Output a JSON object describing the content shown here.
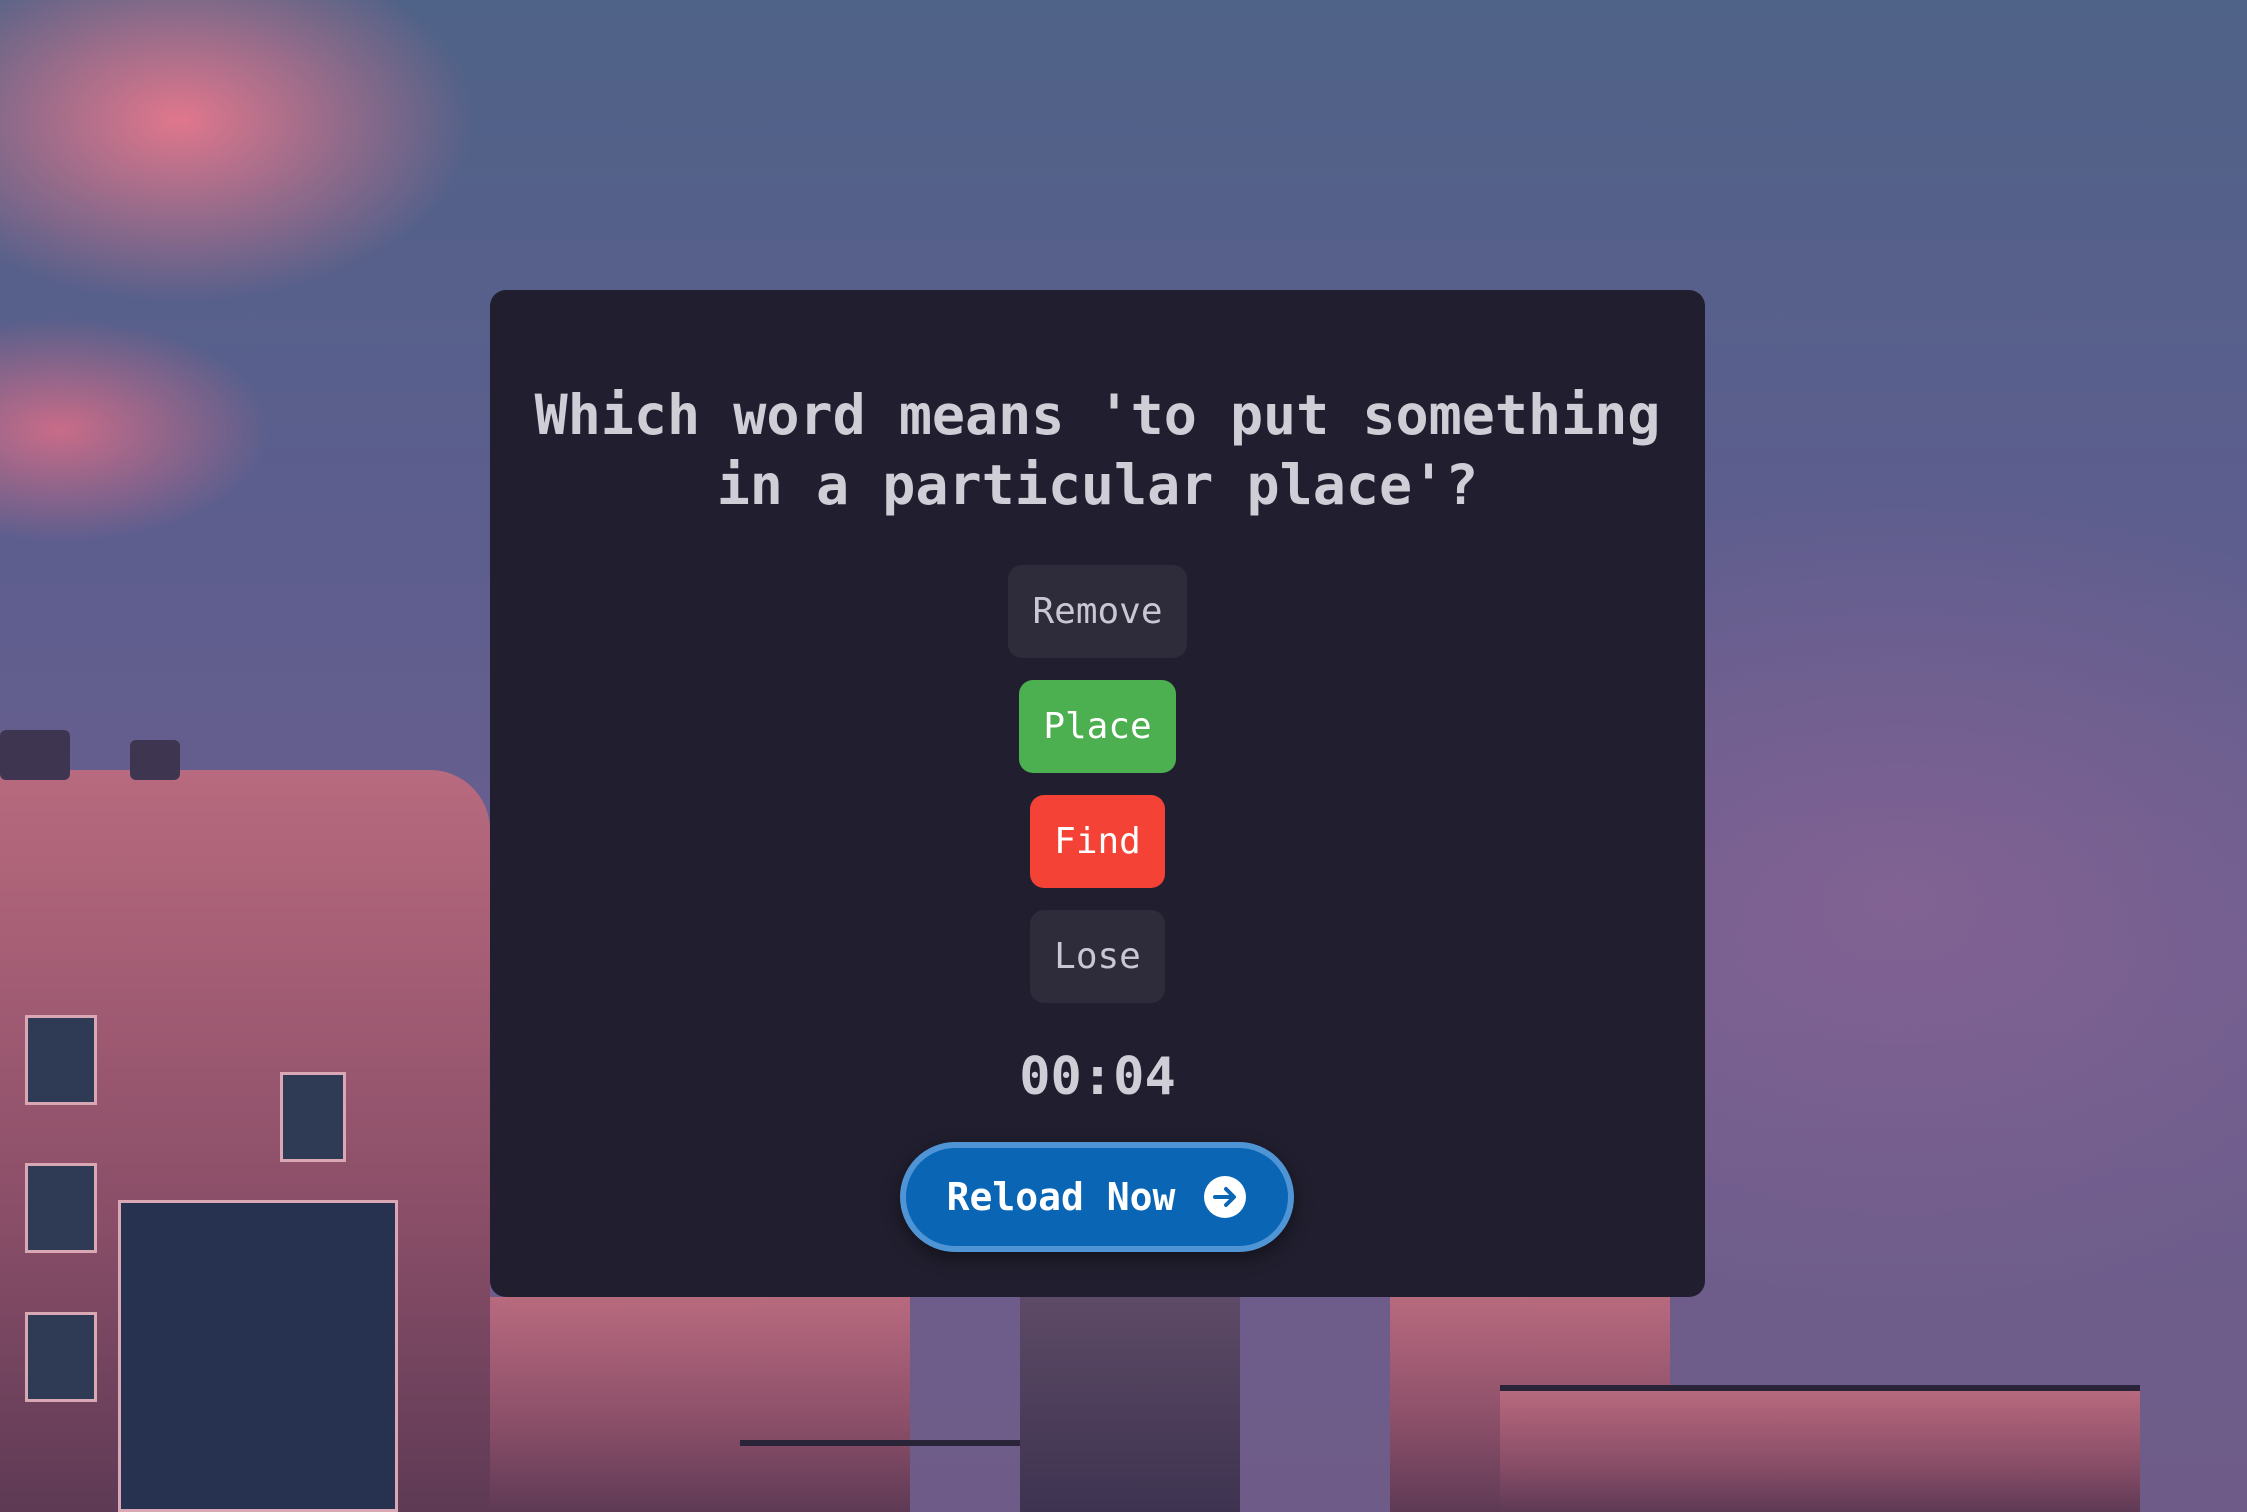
{
  "quiz": {
    "question": "Which word means 'to put something in a particular place'?",
    "options": [
      {
        "label": "Remove",
        "state": "neutral"
      },
      {
        "label": "Place",
        "state": "correct"
      },
      {
        "label": "Find",
        "state": "wrong"
      },
      {
        "label": "Lose",
        "state": "neutral"
      }
    ],
    "timer": "00:04",
    "reload_label": "Reload Now",
    "reload_icon": "arrow-right-circle-icon"
  },
  "colors": {
    "card_bg": "#211f2f",
    "correct": "#4caf50",
    "wrong": "#f44336",
    "neutral": "#2e2c3b",
    "button_primary": "#0a66b5"
  }
}
